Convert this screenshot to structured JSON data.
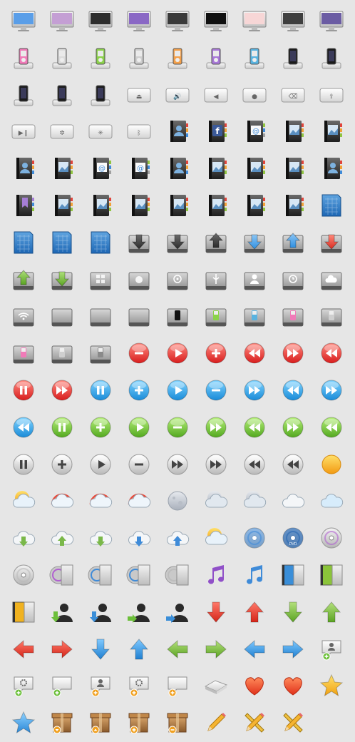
{
  "icon_grid": {
    "columns": 9,
    "rows": [
      [
        "imac-icon",
        "imac-icon",
        "imac-icon",
        "imac-icon",
        "imac-icon",
        "imac-icon",
        "imac-icon",
        "imac-icon",
        "imac-icon"
      ],
      [
        "ipod-dock-icon",
        "ipod-dock-icon",
        "ipod-dock-icon",
        "ipod-dock-icon",
        "ipod-dock-icon",
        "ipod-dock-icon",
        "ipod-dock-icon",
        "iphone-dock-icon",
        "iphone-dock-icon"
      ],
      [
        "iphone-dock-icon",
        "iphone-dock-icon",
        "iphone-dock-icon",
        "eject-key-icon",
        "volume-key-icon",
        "volume-low-key-icon",
        "apple-key-icon",
        "delete-key-icon",
        "upload-key-icon"
      ],
      [
        "play-pause-key-icon",
        "brightness-key-icon",
        "brightness-up-key-icon",
        "bluetooth-key-icon",
        "address-book-icon",
        "facebook-book-icon",
        "email-book-icon",
        "photo-book-icon",
        "photo-book-icon"
      ],
      [
        "address-book-icon",
        "photo-book-icon",
        "email-book-icon",
        "email-book-icon",
        "address-book-icon",
        "photo-book-icon",
        "photo-book-icon",
        "photo-book-icon",
        "address-book-icon"
      ],
      [
        "bookmark-book-icon",
        "photo-book-icon",
        "photo-book-icon",
        "photo-book-icon",
        "photo-book-icon",
        "photo-book-icon",
        "photo-book-icon",
        "photo-book-icon",
        "blueprint-icon"
      ],
      [
        "blueprint-icon",
        "blueprint-icon",
        "blueprint-icon",
        "download-drive-icon",
        "download-drive-icon",
        "upload-drive-icon",
        "download-drive-icon",
        "upload-drive-icon",
        "download-drive-icon"
      ],
      [
        "upload-drive-icon",
        "download-drive-icon",
        "windows-drive-icon",
        "apple-drive-icon",
        "network-drive-icon",
        "usb-drive-icon",
        "user-drive-icon",
        "timemachine-drive-icon",
        "cloud-drive-icon"
      ],
      [
        "wifi-drive-icon",
        "hard-drive-icon",
        "hard-drive-icon",
        "hard-drive-icon",
        "iphone-drive-icon",
        "ipod-drive-icon",
        "ipod-drive-icon",
        "ipod-drive-icon",
        "ipod-drive-icon"
      ],
      [
        "ipod-drive-icon",
        "ipod-drive-icon",
        "ipod-drive-icon",
        "minus-button-icon",
        "play-button-icon",
        "plus-button-icon",
        "rewind-button-icon",
        "fast-forward-button-icon",
        "rewind-button-icon"
      ],
      [
        "pause-button-icon",
        "fast-forward-button-icon",
        "pause-button-icon",
        "plus-button-icon",
        "play-button-icon",
        "minus-button-icon",
        "fast-forward-button-icon",
        "rewind-button-icon",
        "fast-forward-button-icon"
      ],
      [
        "rewind-button-icon",
        "pause-button-icon",
        "plus-button-icon",
        "play-button-icon",
        "minus-button-icon",
        "fast-forward-button-icon",
        "rewind-button-icon",
        "fast-forward-button-icon",
        "rewind-button-icon"
      ],
      [
        "pause-button-icon",
        "plus-button-icon",
        "play-button-icon",
        "minus-button-icon",
        "fast-forward-button-icon",
        "fast-forward-button-icon",
        "rewind-button-icon",
        "rewind-button-icon",
        "sun-icon"
      ],
      [
        "sun-cloud-icon",
        "rainbow-cloud-icon",
        "rainbow-cloud-icon",
        "rainbow-cloud-icon",
        "moon-icon",
        "moon-cloud-icon",
        "moon-cloud-icon",
        "cloud-icon",
        "cloud-icon"
      ],
      [
        "cloud-download-icon",
        "cloud-upload-icon",
        "cloud-download-icon",
        "cloud-download-icon",
        "cloud-upload-icon",
        "sun-cloud-icon",
        "disc-icon",
        "dvd-disc-icon",
        "cd-disc-icon"
      ],
      [
        "cd-disc-icon",
        "disc-case-icon",
        "disc-case-icon",
        "disc-case-icon",
        "disc-case-icon",
        "music-note-icon",
        "music-note-icon",
        "dvd-case-icon",
        "dvd-case-icon"
      ],
      [
        "dvd-case-icon",
        "user-download-icon",
        "user-download-icon",
        "user-transfer-icon",
        "user-transfer-icon",
        "arrow-down-icon",
        "arrow-up-icon",
        "arrow-down-icon",
        "arrow-up-icon"
      ],
      [
        "arrow-left-icon",
        "arrow-right-icon",
        "arrow-down-icon",
        "arrow-up-icon",
        "arrow-left-icon",
        "arrow-right-icon",
        "arrow-left-icon",
        "arrow-right-icon",
        "user-chat-add-icon"
      ],
      [
        "settings-chat-add-icon",
        "chat-add-icon",
        "user-chat-add-icon",
        "settings-chat-add-icon",
        "chat-add-icon",
        "mac-mini-icon",
        "heart-icon",
        "heart-icon",
        "star-icon"
      ],
      [
        "star-icon",
        "box-download-icon",
        "box-upload-icon",
        "box-add-icon",
        "box-remove-icon",
        "pencil-icon",
        "pencil-ruler-icon",
        "pencil-ruler-icon",
        ""
      ]
    ]
  }
}
